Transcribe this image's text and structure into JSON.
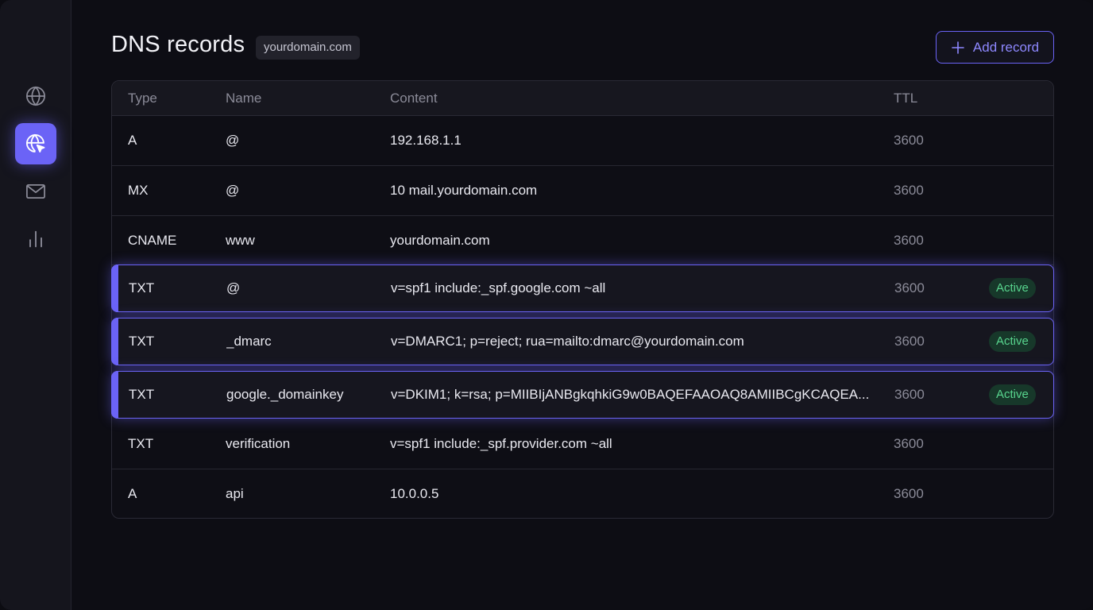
{
  "header": {
    "title": "DNS records",
    "domain": "yourdomain.com",
    "add_button_label": "Add record"
  },
  "sidebar": {
    "items": [
      {
        "icon": "globe-icon",
        "active": false
      },
      {
        "icon": "globe-cursor-icon",
        "active": true
      },
      {
        "icon": "mail-icon",
        "active": false
      },
      {
        "icon": "bar-chart-icon",
        "active": false
      }
    ]
  },
  "table": {
    "columns": {
      "type": "Type",
      "name": "Name",
      "content": "Content",
      "ttl": "TTL"
    },
    "rows": [
      {
        "type": "A",
        "name": "@",
        "content": "192.168.1.1",
        "ttl": "3600",
        "status": ""
      },
      {
        "type": "MX",
        "name": "@",
        "content": "10 mail.yourdomain.com",
        "ttl": "3600",
        "status": ""
      },
      {
        "type": "CNAME",
        "name": "www",
        "content": "yourdomain.com",
        "ttl": "3600",
        "status": ""
      },
      {
        "type": "TXT",
        "name": "@",
        "content": "v=spf1 include:_spf.google.com ~all",
        "ttl": "3600",
        "status": "Active"
      },
      {
        "type": "TXT",
        "name": "_dmarc",
        "content": "v=DMARC1; p=reject; rua=mailto:dmarc@yourdomain.com",
        "ttl": "3600",
        "status": "Active"
      },
      {
        "type": "TXT",
        "name": "google._domainkey",
        "content": "v=DKIM1; k=rsa; p=MIIBIjANBgkqhkiG9w0BAQEFAAOAQ8AMIIBCgKCAQEA...",
        "ttl": "3600",
        "status": "Active"
      },
      {
        "type": "TXT",
        "name": "verification",
        "content": "v=spf1 include:_spf.provider.com ~all",
        "ttl": "3600",
        "status": ""
      },
      {
        "type": "A",
        "name": "api",
        "content": "10.0.0.5",
        "ttl": "3600",
        "status": ""
      }
    ]
  },
  "colors": {
    "accent": "#6b63f6",
    "status_active_bg": "#17382a",
    "status_active_text": "#58d58e",
    "background": "#0d0d14"
  }
}
